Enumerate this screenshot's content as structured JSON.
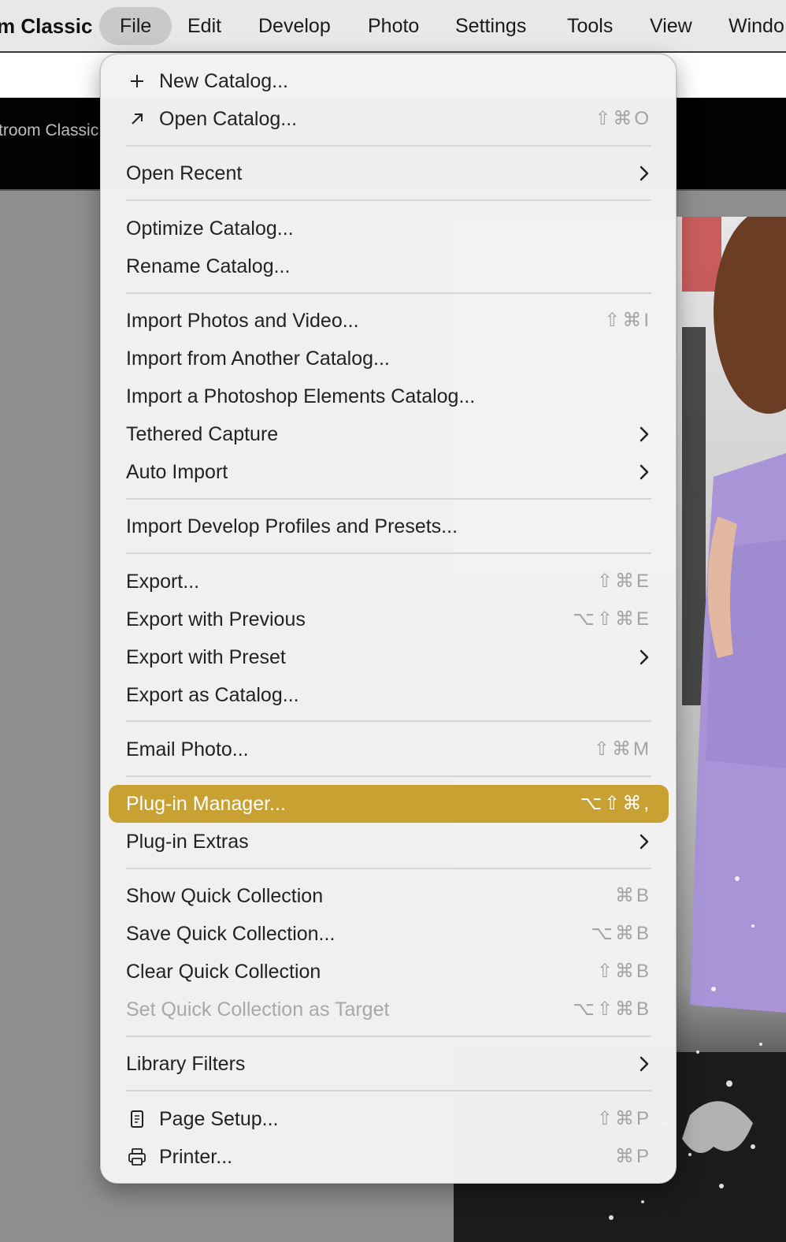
{
  "menubar": {
    "app_name": "m Classic",
    "items": [
      "File",
      "Edit",
      "Develop",
      "Photo",
      "Settings",
      "Tools",
      "View",
      "Windo"
    ]
  },
  "lightroom": {
    "title": "troom Classic"
  },
  "menu": {
    "accent_color": "#c9a032",
    "items": {
      "new_catalog": {
        "label": "New Catalog...",
        "icon": "plus-icon"
      },
      "open_catalog": {
        "label": "Open Catalog...",
        "icon": "arrow-up-right-icon",
        "shortcut": "⇧⌘O"
      },
      "open_recent": {
        "label": "Open Recent"
      },
      "optimize_catalog": {
        "label": "Optimize Catalog..."
      },
      "rename_catalog": {
        "label": "Rename Catalog..."
      },
      "import_photos": {
        "label": "Import Photos and Video...",
        "shortcut": "⇧⌘I"
      },
      "import_catalog": {
        "label": "Import from Another Catalog..."
      },
      "import_pse": {
        "label": "Import a Photoshop Elements Catalog..."
      },
      "tethered_capture": {
        "label": "Tethered Capture"
      },
      "auto_import": {
        "label": "Auto Import"
      },
      "import_profiles": {
        "label": "Import Develop Profiles and Presets..."
      },
      "export": {
        "label": "Export...",
        "shortcut": "⇧⌘E"
      },
      "export_previous": {
        "label": "Export with Previous",
        "shortcut": "⌥⇧⌘E"
      },
      "export_preset": {
        "label": "Export with Preset"
      },
      "export_catalog": {
        "label": "Export as Catalog..."
      },
      "email_photo": {
        "label": "Email Photo...",
        "shortcut": "⇧⌘M"
      },
      "plugin_manager": {
        "label": "Plug-in Manager...",
        "shortcut": "⌥⇧⌘,"
      },
      "plugin_extras": {
        "label": "Plug-in Extras"
      },
      "show_quick": {
        "label": "Show Quick Collection",
        "shortcut": "⌘B"
      },
      "save_quick": {
        "label": "Save Quick Collection...",
        "shortcut": "⌥⌘B"
      },
      "clear_quick": {
        "label": "Clear Quick Collection",
        "shortcut": "⇧⌘B"
      },
      "set_quick_target": {
        "label": "Set Quick Collection as Target",
        "shortcut": "⌥⇧⌘B"
      },
      "library_filters": {
        "label": "Library Filters"
      },
      "page_setup": {
        "label": "Page Setup...",
        "icon": "page-setup-icon",
        "shortcut": "⇧⌘P"
      },
      "printer": {
        "label": "Printer...",
        "icon": "printer-icon",
        "shortcut": "⌘P"
      }
    }
  }
}
